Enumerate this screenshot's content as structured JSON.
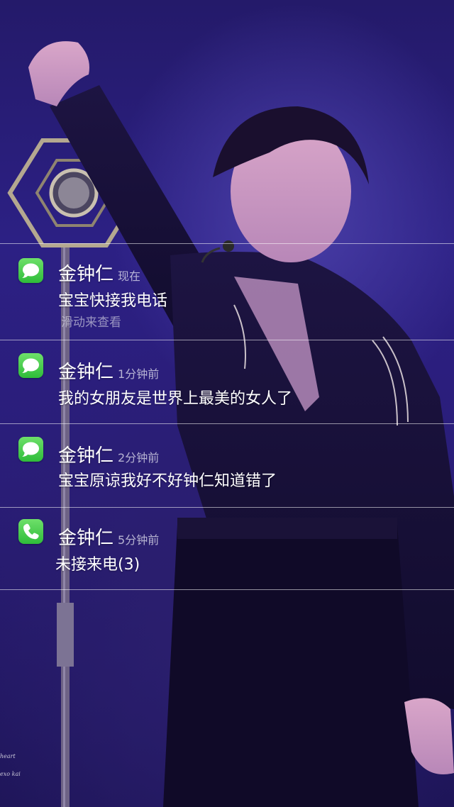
{
  "wallpaper": {
    "watermark_line1": "heart",
    "watermark_line2": "exo kai"
  },
  "notifications": [
    {
      "app_icon": "message-icon",
      "sender": "金钟仁",
      "time": "现在",
      "message": "宝宝快接我电话",
      "hint": "滑动来查看"
    },
    {
      "app_icon": "message-icon",
      "sender": "金钟仁",
      "time": "1分钟前",
      "message": "我的女朋友是世界上最美的女人了"
    },
    {
      "app_icon": "message-icon",
      "sender": "金钟仁",
      "time": "2分钟前",
      "message": "宝宝原谅我好不好钟仁知道错了"
    },
    {
      "app_icon": "phone-icon",
      "sender": "金钟仁",
      "time": "5分钟前",
      "message": "未接来电(3)"
    }
  ],
  "colors": {
    "icon_green": "#3cc33f",
    "background_purple": "#2c2084"
  }
}
